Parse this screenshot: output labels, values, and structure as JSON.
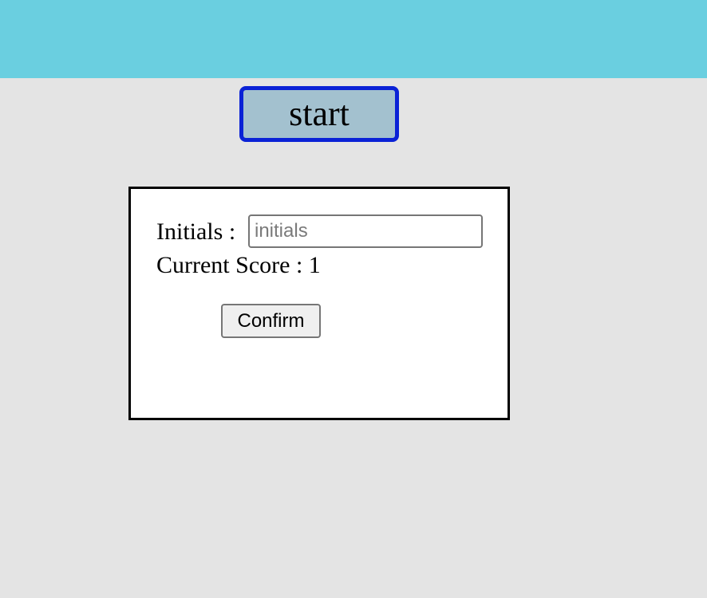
{
  "header": {
    "start_label": "start"
  },
  "score_form": {
    "initials_label": "Initials :",
    "initials_value": "",
    "initials_placeholder": "initials",
    "score_label": "Current Score :",
    "score_value": "1",
    "confirm_label": "Confirm"
  },
  "colors": {
    "top_bar": "#6acfe0",
    "page_background": "#e4e4e4",
    "start_button_fill": "#a3c1cf",
    "start_button_border": "#0a22d6",
    "panel_background": "#ffffff",
    "panel_border": "#000000"
  }
}
